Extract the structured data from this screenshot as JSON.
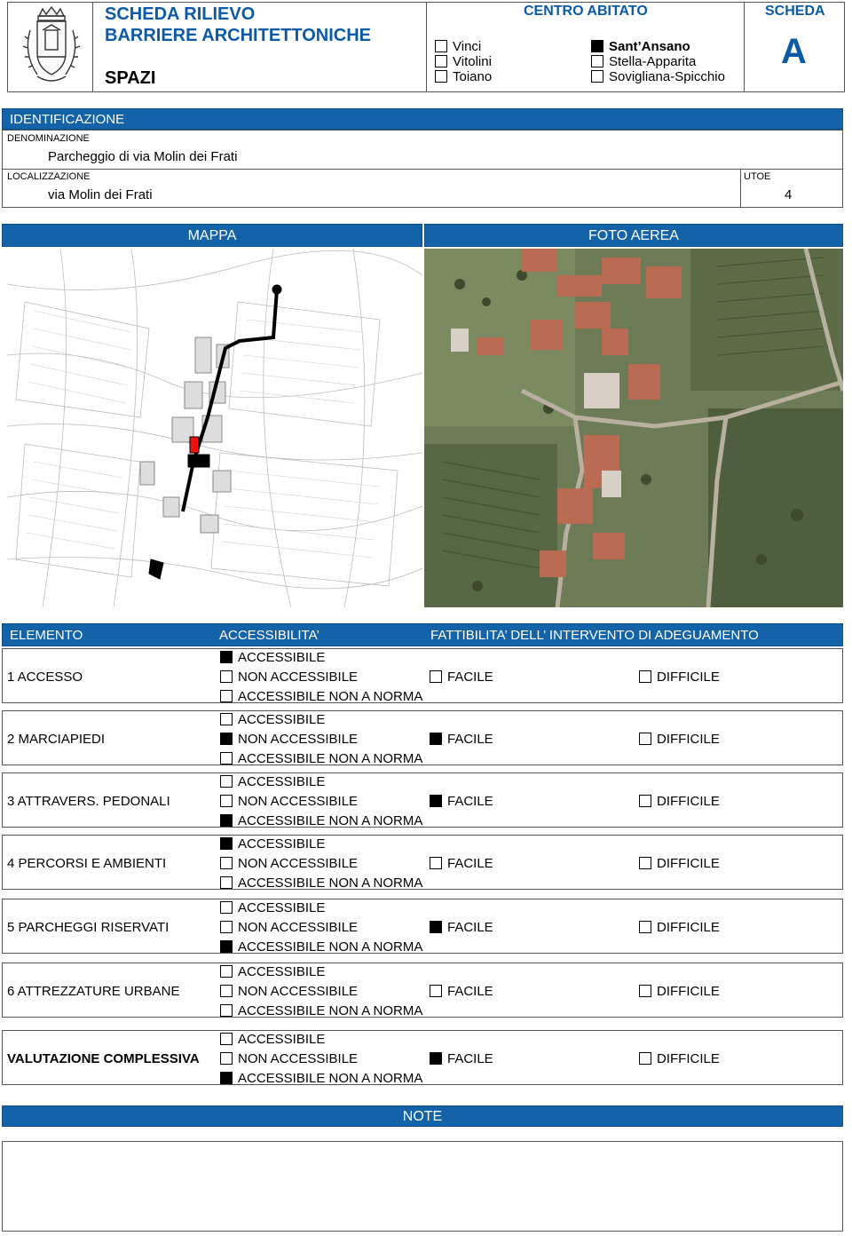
{
  "header": {
    "title_line1": "SCHEDA RILIEVO",
    "title_line2": "BARRIERE ARCHITETTONICHE",
    "subtitle": "SPAZI",
    "centro_label": "CENTRO ABITATO",
    "scheda_label": "SCHEDA",
    "scheda_code": "A",
    "localities_col1": [
      {
        "label": "Vinci",
        "checked": false
      },
      {
        "label": "Vitolini",
        "checked": false
      },
      {
        "label": "Toiano",
        "checked": false
      }
    ],
    "localities_col2": [
      {
        "label": "Sant’Ansano",
        "checked": true
      },
      {
        "label": "Stella-Apparita",
        "checked": false
      },
      {
        "label": "Sovigliana-Spicchio",
        "checked": false
      }
    ]
  },
  "identification": {
    "section_label": "IDENTIFICAZIONE",
    "denominazione_label": "DENOMINAZIONE",
    "denominazione_value": "Parcheggio di via Molin dei Frati",
    "localizzazione_label": "LOCALIZZAZIONE",
    "localizzazione_value": "via Molin dei Frati",
    "utoe_label": "UTOE",
    "utoe_value": "4"
  },
  "images": {
    "map_label": "MAPPA",
    "aerial_label": "FOTO AEREA"
  },
  "assessment": {
    "col_element": "ELEMENTO",
    "col_accessibility": "ACCESSIBILITA’",
    "col_feasibility": "FATTIBILITA’ DELL’ INTERVENTO DI ADEGUAMENTO",
    "opt_accessible": "ACCESSIBILE",
    "opt_non_accessible": "NON ACCESSIBILE",
    "opt_not_compliant": "ACCESSIBILE NON A NORMA",
    "opt_easy": "FACILE",
    "opt_difficult": "DIFFICILE",
    "rows": [
      {
        "name": "1 ACCESSO",
        "accessibility": "ACCESSIBILE",
        "feasibility": ""
      },
      {
        "name": "2 MARCIAPIEDI",
        "accessibility": "NON ACCESSIBILE",
        "feasibility": "FACILE"
      },
      {
        "name": "3 ATTRAVERS. PEDONALI",
        "accessibility": "ACCESSIBILE NON A NORMA",
        "feasibility": "FACILE"
      },
      {
        "name": "4 PERCORSI E AMBIENTI",
        "accessibility": "ACCESSIBILE",
        "feasibility": ""
      },
      {
        "name": "5 PARCHEGGI RISERVATI",
        "accessibility": "ACCESSIBILE NON A NORMA",
        "feasibility": "FACILE"
      },
      {
        "name": "6 ATTREZZATURE URBANE",
        "accessibility": "",
        "feasibility": ""
      },
      {
        "name": "VALUTAZIONE COMPLESSIVA",
        "accessibility": "ACCESSIBILE NON A NORMA",
        "feasibility": "FACILE",
        "bold": true
      }
    ]
  },
  "notes": {
    "label": "NOTE",
    "content": ""
  }
}
